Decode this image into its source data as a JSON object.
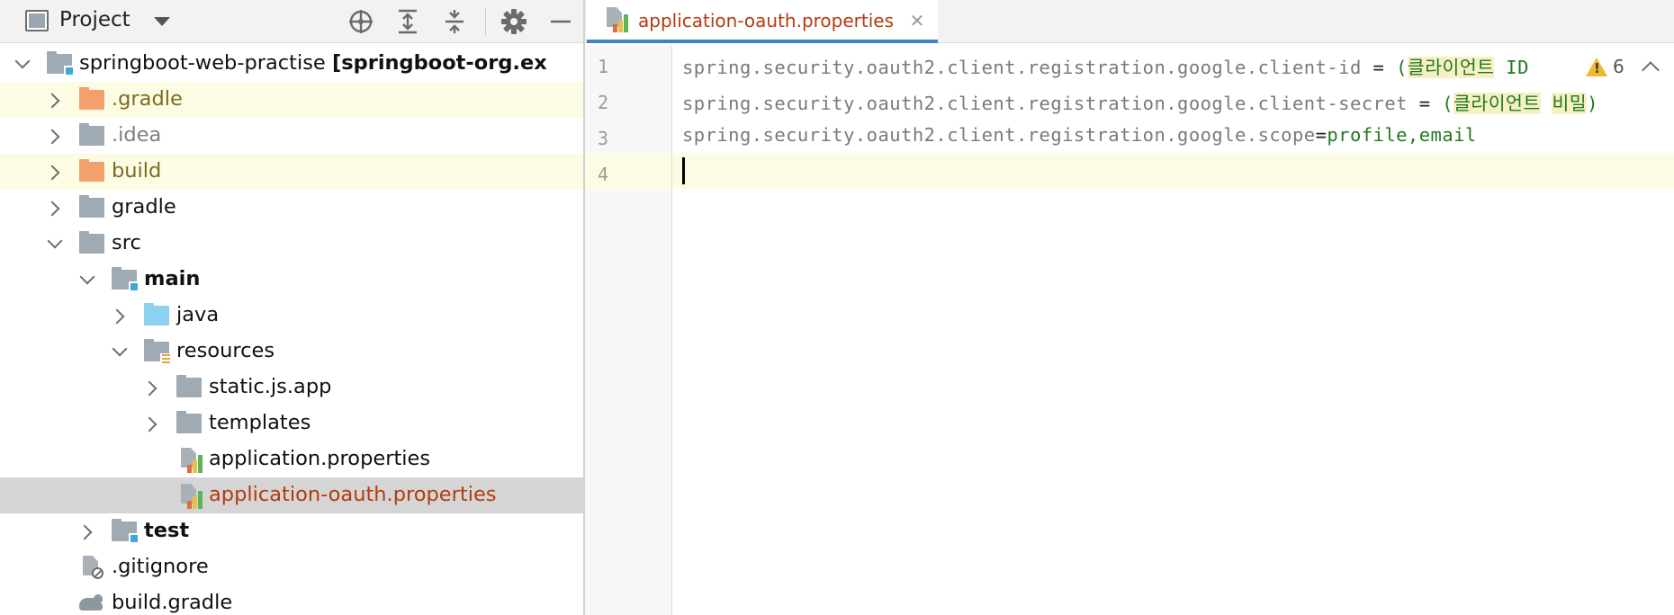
{
  "project_pane": {
    "title": "Project",
    "toolbar": [
      "locate-icon",
      "expand-all-icon",
      "collapse-all-icon",
      "gear-icon",
      "minimize-icon"
    ],
    "tree": [
      {
        "label": "springboot-web-practise",
        "suffix": "[springboot-org.ex",
        "expanded": true
      },
      {
        "label": ".gradle",
        "expanded": false
      },
      {
        "label": ".idea",
        "expanded": false
      },
      {
        "label": "build",
        "expanded": false
      },
      {
        "label": "gradle",
        "expanded": false
      },
      {
        "label": "src",
        "expanded": true
      },
      {
        "label": "main",
        "expanded": true
      },
      {
        "label": "java",
        "expanded": false
      },
      {
        "label": "resources",
        "expanded": true
      },
      {
        "label": "static.js.app",
        "expanded": false
      },
      {
        "label": "templates",
        "expanded": false
      },
      {
        "label": "application.properties"
      },
      {
        "label": "application-oauth.properties",
        "selected": true
      },
      {
        "label": "test",
        "expanded": false
      },
      {
        "label": ".gitignore"
      },
      {
        "label": "build.gradle"
      }
    ]
  },
  "editor": {
    "tab": {
      "label": "application-oauth.properties",
      "close_icon": "close-icon"
    },
    "line_numbers": [
      "1",
      "2",
      "3",
      "4"
    ],
    "lines": [
      {
        "key": "spring.security.oauth2.client.registration.google.client-id",
        "sep": " = ",
        "value_open": "(",
        "value_korean": "클라이언트",
        "value_rest": " ID"
      },
      {
        "key": "spring.security.oauth2.client.registration.google.client-secret",
        "sep": " = ",
        "value_open": "(",
        "value_korean": "클라이언트",
        "value_space": " ",
        "value_korean2": "비밀",
        "value_close": ")"
      },
      {
        "key": "spring.security.oauth2.client.registration.google.scope",
        "sep": "=",
        "value": "profile,email"
      },
      {
        "key": ""
      }
    ],
    "inspection": {
      "icon": "warning-icon",
      "count": "6",
      "nav_icon": "chevron-up-icon"
    }
  },
  "colors": {
    "accent": "#4083c9",
    "selected_file": "#b23c0f",
    "string_value": "#1f7a1f",
    "highlight_row": "#fcfce5",
    "warning": "#f0b72f"
  }
}
